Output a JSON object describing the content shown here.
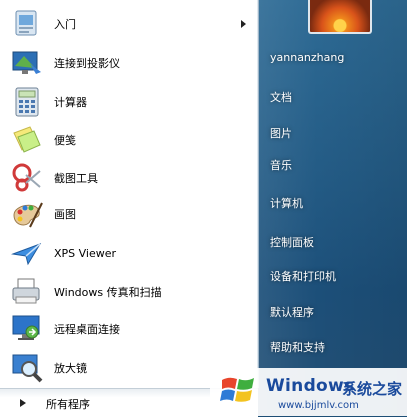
{
  "user": {
    "name": "yannanzhang"
  },
  "programs": [
    {
      "label": "入门",
      "icon": "getting-started-icon",
      "has_arrow": true
    },
    {
      "label": "连接到投影仪",
      "icon": "projector-icon"
    },
    {
      "label": "计算器",
      "icon": "calculator-icon"
    },
    {
      "label": "便笺",
      "icon": "sticky-notes-icon"
    },
    {
      "label": "截图工具",
      "icon": "snipping-tool-icon"
    },
    {
      "label": "画图",
      "icon": "paint-icon"
    },
    {
      "label": "XPS Viewer",
      "icon": "xps-viewer-icon"
    },
    {
      "label": "Windows 传真和扫描",
      "icon": "fax-scan-icon"
    },
    {
      "label": "远程桌面连接",
      "icon": "remote-desktop-icon"
    },
    {
      "label": "放大镜",
      "icon": "magnifier-icon"
    }
  ],
  "all_programs": "所有程序",
  "right_items": [
    "文档",
    "图片",
    "音乐",
    "计算机",
    "控制面板",
    "设备和打印机",
    "默认程序",
    "帮助和支持"
  ],
  "watermark": {
    "brand": "Windows",
    "brand_cn": "系统之家",
    "url": "www.bjjmlv.com"
  },
  "colors": {
    "aero": "#245c86",
    "watermark_blue": "#1a4a9c"
  }
}
